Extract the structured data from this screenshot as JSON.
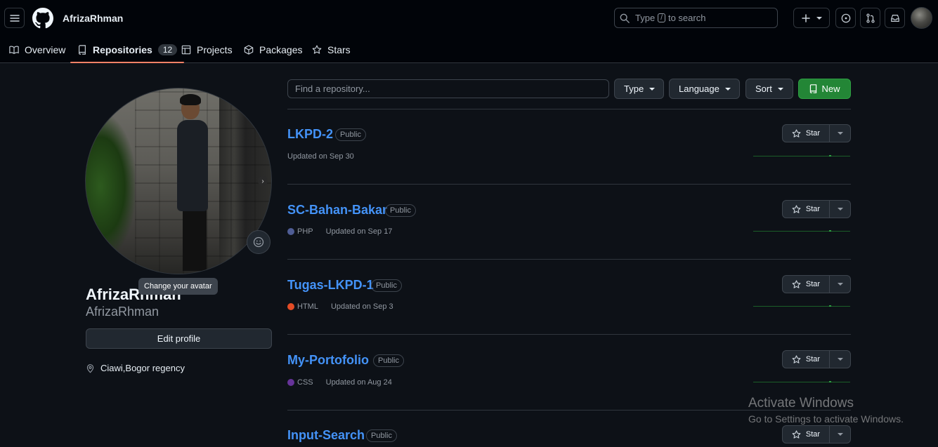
{
  "header": {
    "username": "AfrizaRhman",
    "search_placeholder_pre": "Type",
    "search_key": "/",
    "search_placeholder_post": "to search"
  },
  "nav": {
    "tabs": [
      {
        "label": "Overview"
      },
      {
        "label": "Repositories",
        "count": "12"
      },
      {
        "label": "Projects"
      },
      {
        "label": "Packages"
      },
      {
        "label": "Stars"
      }
    ]
  },
  "profile": {
    "display_name": "AfrizaRhman",
    "login": "AfrizaRhman",
    "avatar_tooltip": "Change your avatar",
    "edit_label": "Edit profile",
    "location": "Ciawi,Bogor regency"
  },
  "filters": {
    "find_placeholder": "Find a repository...",
    "type_label": "Type",
    "language_label": "Language",
    "sort_label": "Sort",
    "new_label": "New"
  },
  "repos": [
    {
      "name": "LKPD-2",
      "visibility": "Public",
      "language": "",
      "lang_color": "",
      "updated": "Updated on Sep 30",
      "star_label": "Star"
    },
    {
      "name": "SC-Bahan-Bakar",
      "visibility": "Public",
      "language": "PHP",
      "lang_color": "#4F5D95",
      "updated": "Updated on Sep 17",
      "star_label": "Star"
    },
    {
      "name": "Tugas-LKPD-1",
      "visibility": "Public",
      "language": "HTML",
      "lang_color": "#e34c26",
      "updated": "Updated on Sep 3",
      "star_label": "Star"
    },
    {
      "name": "My-Portofolio",
      "visibility": "Public",
      "language": "CSS",
      "lang_color": "#663399",
      "updated": "Updated on Aug 24",
      "star_label": "Star"
    },
    {
      "name": "Input-Search",
      "visibility": "Public",
      "language": "",
      "lang_color": "",
      "updated": "",
      "star_label": "Star"
    }
  ],
  "watermark": {
    "line1": "Activate Windows",
    "line2": "Go to Settings to activate Windows."
  },
  "colors": {
    "background": "#0d1117",
    "header_bg": "#010409",
    "link": "#4493f8",
    "primary_button": "#238636",
    "active_tab_underline": "#f78166"
  }
}
